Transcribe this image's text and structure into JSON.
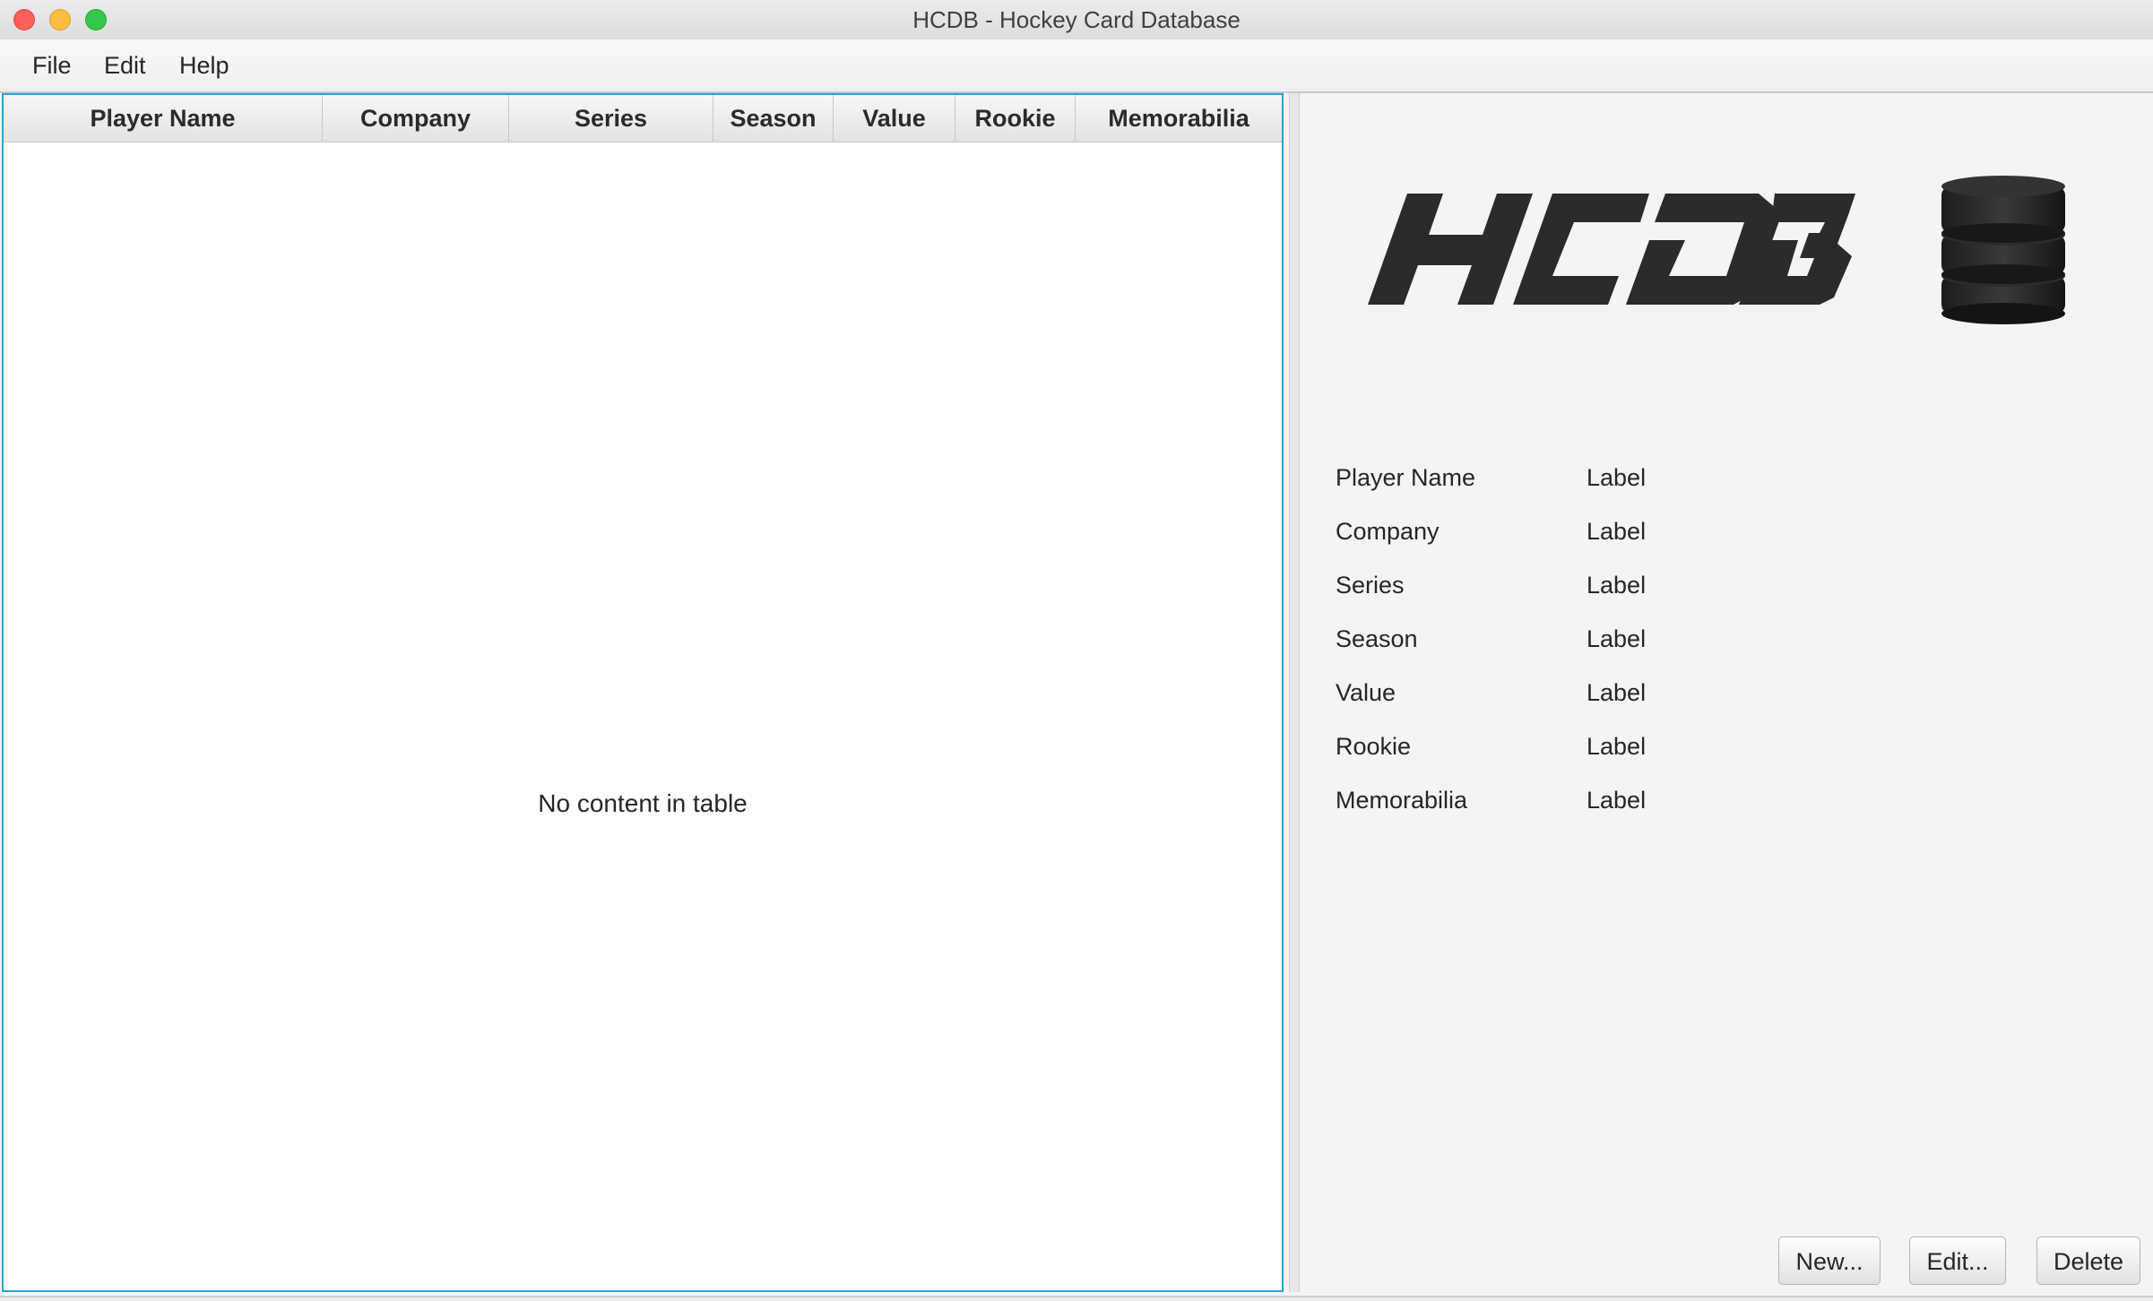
{
  "window": {
    "title": "HCDB - Hockey Card Database"
  },
  "menu": {
    "items": [
      {
        "label": "File"
      },
      {
        "label": "Edit"
      },
      {
        "label": "Help"
      }
    ]
  },
  "table": {
    "columns": [
      {
        "label": "Player Name"
      },
      {
        "label": "Company"
      },
      {
        "label": "Series"
      },
      {
        "label": "Season"
      },
      {
        "label": "Value"
      },
      {
        "label": "Rookie"
      },
      {
        "label": "Memorabilia"
      }
    ],
    "rows": [],
    "empty_message": "No content in table"
  },
  "details": {
    "logo_text": "HCDB",
    "logo_icon": "hockey-puck-stack-icon",
    "fields": [
      {
        "label": "Player Name",
        "value": "Label"
      },
      {
        "label": "Company",
        "value": "Label"
      },
      {
        "label": "Series",
        "value": "Label"
      },
      {
        "label": "Season",
        "value": "Label"
      },
      {
        "label": "Value",
        "value": "Label"
      },
      {
        "label": "Rookie",
        "value": "Label"
      },
      {
        "label": "Memorabilia",
        "value": "Label"
      }
    ]
  },
  "buttons": {
    "new_label": "New...",
    "edit_label": "Edit...",
    "delete_label": "Delete"
  },
  "colors": {
    "focus_border": "#2aa3d6",
    "close": "#fc605b",
    "minimize": "#fdbc40",
    "maximize": "#34c84a"
  }
}
